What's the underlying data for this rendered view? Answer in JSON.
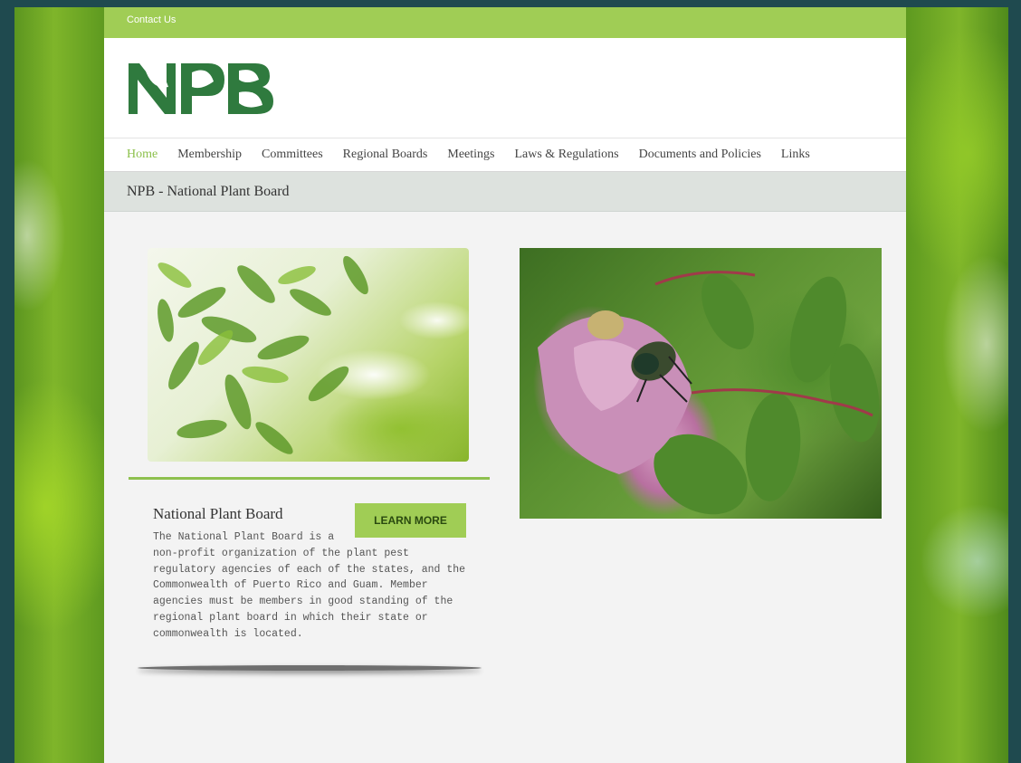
{
  "topbar": {
    "contact_label": "Contact Us"
  },
  "logo": {
    "text": "NPB",
    "color": "#2f7a3e"
  },
  "nav": {
    "items": [
      {
        "label": "Home",
        "active": true
      },
      {
        "label": "Membership"
      },
      {
        "label": "Committees"
      },
      {
        "label": "Regional Boards"
      },
      {
        "label": "Meetings"
      },
      {
        "label": "Laws & Regulations"
      },
      {
        "label": "Documents and Policies"
      },
      {
        "label": "Links"
      }
    ]
  },
  "page_title": "NPB - National Plant Board",
  "card": {
    "title": "National Plant Board",
    "text_first": "The National Plant Board is a",
    "text_rest": "non-profit organization of the plant pest regulatory agencies of each of the states, and the Commonwealth of Puerto Rico and Guam. Member agencies must be members in good standing of the regional plant board in which their state or commonwealth is located.",
    "button_label": "LEARN MORE"
  },
  "colors": {
    "accent": "#a0cd55",
    "nav_active": "#8cc04b"
  }
}
